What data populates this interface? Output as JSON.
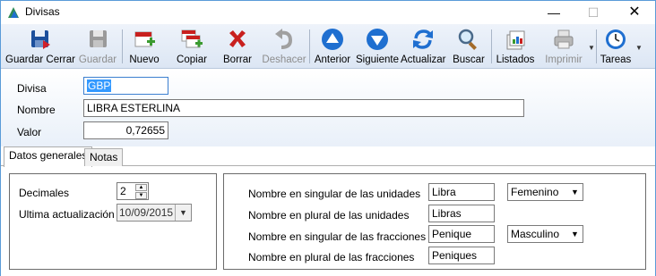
{
  "window": {
    "title": "Divisas"
  },
  "toolbar": {
    "guardar_cerrar": "Guardar Cerrar",
    "guardar": "Guardar",
    "nuevo": "Nuevo",
    "copiar": "Copiar",
    "borrar": "Borrar",
    "deshacer": "Deshacer",
    "anterior": "Anterior",
    "siguiente": "Siguiente",
    "actualizar": "Actualizar",
    "buscar": "Buscar",
    "listados": "Listados",
    "imprimir": "Imprimir",
    "tareas": "Tareas"
  },
  "form": {
    "divisa_label": "Divisa",
    "divisa_value": "GBP",
    "nombre_label": "Nombre",
    "nombre_value": "LIBRA ESTERLINA",
    "valor_label": "Valor",
    "valor_value": "0,72655"
  },
  "tabs": [
    "Datos generales",
    "Notas"
  ],
  "general": {
    "decimales_label": "Decimales",
    "decimales_value": "2",
    "ultima_label": "Ultima actualización",
    "ultima_value": "10/09/2015"
  },
  "units": {
    "singular_units_label": "Nombre en singular de las unidades",
    "singular_units_value": "Libra",
    "singular_units_gender": "Femenino",
    "plural_units_label": "Nombre en plural de las unidades",
    "plural_units_value": "Libras",
    "singular_frac_label": "Nombre en singular de las fracciones",
    "singular_frac_value": "Penique",
    "singular_frac_gender": "Masculino",
    "plural_frac_label": "Nombre en plural de las fracciones",
    "plural_frac_value": "Peniques"
  },
  "window_controls": {
    "minimize": "—",
    "maximize": "☐",
    "close": "✕"
  },
  "colors": {
    "accent_blue": "#1f6fd0",
    "delete_red": "#c8201e",
    "add_green": "#3a9a2f"
  }
}
